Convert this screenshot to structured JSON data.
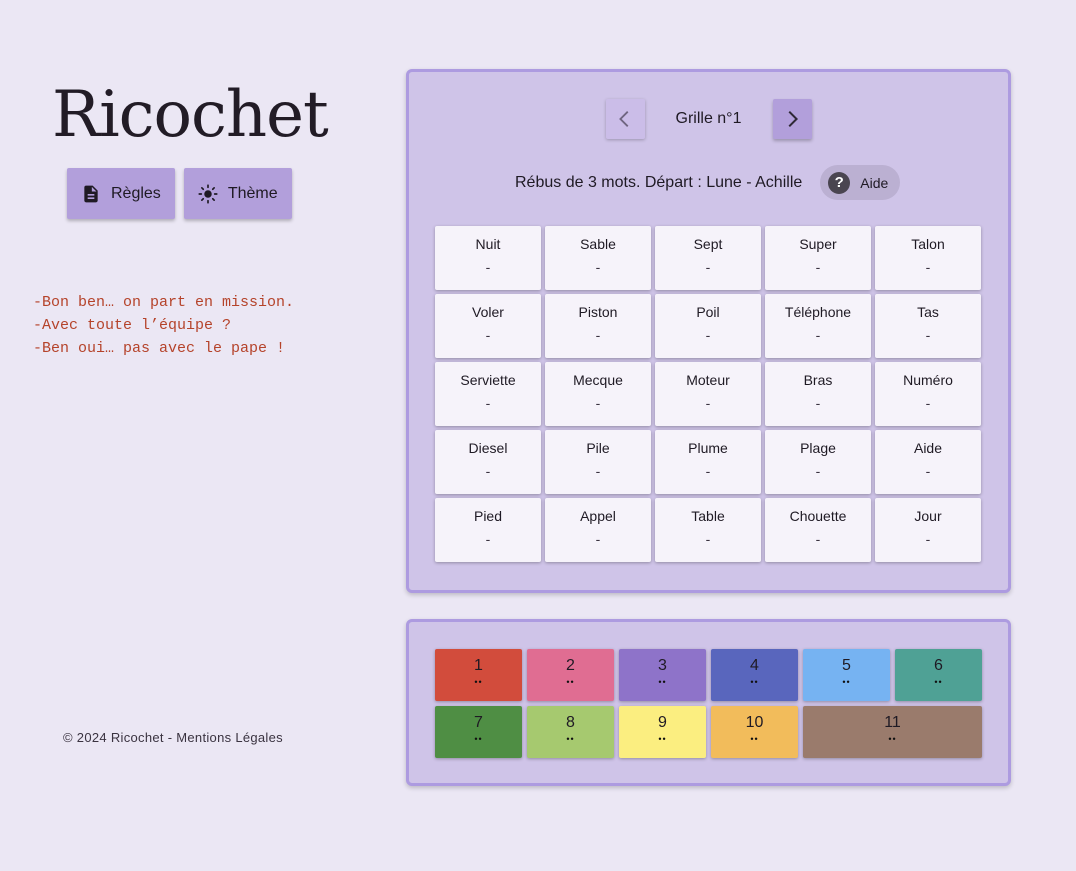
{
  "app": {
    "title": "Ricochet",
    "buttons": [
      {
        "label": "Règles",
        "icon": "document-icon"
      },
      {
        "label": "Thème",
        "icon": "sun-icon"
      }
    ],
    "quote": "-Bon ben… on part en mission.\n-Avec toute l’équipe ?\n-Ben oui… pas avec le pape !",
    "footer": "© 2024 Ricochet - Mentions Légales"
  },
  "grid_panel": {
    "grid_label": "Grille n°1",
    "description": "Rébus de 3 mots. Départ : Lune - Achille",
    "help_label": "Aide",
    "prev_disabled": true,
    "cells": [
      {
        "word": "Nuit",
        "value": "-"
      },
      {
        "word": "Sable",
        "value": "-"
      },
      {
        "word": "Sept",
        "value": "-"
      },
      {
        "word": "Super",
        "value": "-"
      },
      {
        "word": "Talon",
        "value": "-"
      },
      {
        "word": "Voler",
        "value": "-"
      },
      {
        "word": "Piston",
        "value": "-"
      },
      {
        "word": "Poil",
        "value": "-"
      },
      {
        "word": "Téléphone",
        "value": "-"
      },
      {
        "word": "Tas",
        "value": "-"
      },
      {
        "word": "Serviette",
        "value": "-"
      },
      {
        "word": "Mecque",
        "value": "-"
      },
      {
        "word": "Moteur",
        "value": "-"
      },
      {
        "word": "Bras",
        "value": "-"
      },
      {
        "word": "Numéro",
        "value": "-"
      },
      {
        "word": "Diesel",
        "value": "-"
      },
      {
        "word": "Pile",
        "value": "-"
      },
      {
        "word": "Plume",
        "value": "-"
      },
      {
        "word": "Plage",
        "value": "-"
      },
      {
        "word": "Aide",
        "value": "-"
      },
      {
        "word": "Pied",
        "value": "-"
      },
      {
        "word": "Appel",
        "value": "-"
      },
      {
        "word": "Table",
        "value": "-"
      },
      {
        "word": "Chouette",
        "value": "-"
      },
      {
        "word": "Jour",
        "value": "-"
      }
    ]
  },
  "color_panel": {
    "swatches": [
      {
        "number": "1",
        "color": "#d24c3c",
        "dots": "••"
      },
      {
        "number": "2",
        "color": "#e06d92",
        "dots": "••"
      },
      {
        "number": "3",
        "color": "#8e73c9",
        "dots": "••"
      },
      {
        "number": "4",
        "color": "#5966bd",
        "dots": "••"
      },
      {
        "number": "5",
        "color": "#76b3f2",
        "dots": "••"
      },
      {
        "number": "6",
        "color": "#4fa195",
        "dots": "••"
      },
      {
        "number": "7",
        "color": "#4f8e44",
        "dots": "••"
      },
      {
        "number": "8",
        "color": "#a6c96f",
        "dots": "••"
      },
      {
        "number": "9",
        "color": "#fbee80",
        "dots": "••"
      },
      {
        "number": "10",
        "color": "#f2bc5b",
        "dots": "••"
      },
      {
        "number": "11",
        "color": "#9a7b6c",
        "dots": "••"
      }
    ]
  }
}
